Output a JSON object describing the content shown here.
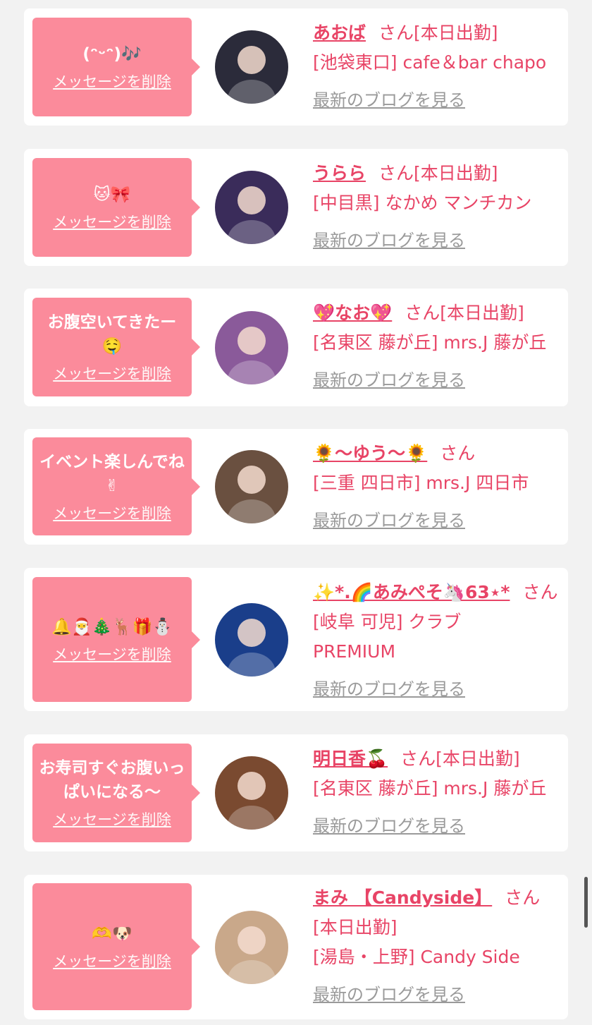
{
  "delete_label": "メッセージを削除",
  "blog_label": "最新のブログを見る",
  "san_label": "さん",
  "accent_color": "#e84466",
  "bubble_color": "#fb8b9b",
  "cards": [
    {
      "message": "(ᵔᵕᵔ)🎶",
      "name": "あおば",
      "line1": "[本日出勤]",
      "line2": "[池袋東口] cafe＆bar chapo",
      "line3": "",
      "avatar_color": "#2b2b3a"
    },
    {
      "message": "🐱🎀",
      "name": "うらら",
      "line1": "[本日出勤]",
      "line2": "[中目黒] なかめ マンチカン",
      "line3": "",
      "avatar_color": "#3a2c5a"
    },
    {
      "message": "お腹空いてきたー🤤",
      "name": "💖なお💖",
      "line1": "[本日出勤]",
      "line2": "[名東区 藤が丘] mrs.J 藤が丘",
      "line3": "",
      "avatar_color": "#8a5a9a"
    },
    {
      "message": "イベント楽しんでね✌",
      "name": "🌻〜ゆう〜🌻",
      "line1": "",
      "line2": "[三重 四日市] mrs.J 四日市",
      "line3": "",
      "avatar_color": "#6a5040"
    },
    {
      "message": "🔔🎅🎄🦌🎁⛄",
      "name": "✨*.🌈あみぺそ🦄63⋆*",
      "line1": "",
      "line2": "[岐阜 可児] クラブ",
      "line3": "PREMIUM",
      "avatar_color": "#1a3e8a"
    },
    {
      "message": "お寿司すぐお腹いっぱいになる〜",
      "name": "明日香🍒",
      "line1": "[本日出勤]",
      "line2": "[名東区 藤が丘] mrs.J 藤が丘",
      "line3": "",
      "avatar_color": "#7a4a30"
    },
    {
      "message": "🫶🐶",
      "name": "まみ 【Candyside】",
      "line1": "[本日出勤]",
      "line2": "[湯島・上野] Candy Side",
      "line3": "",
      "avatar_color": "#c9a88a"
    }
  ]
}
